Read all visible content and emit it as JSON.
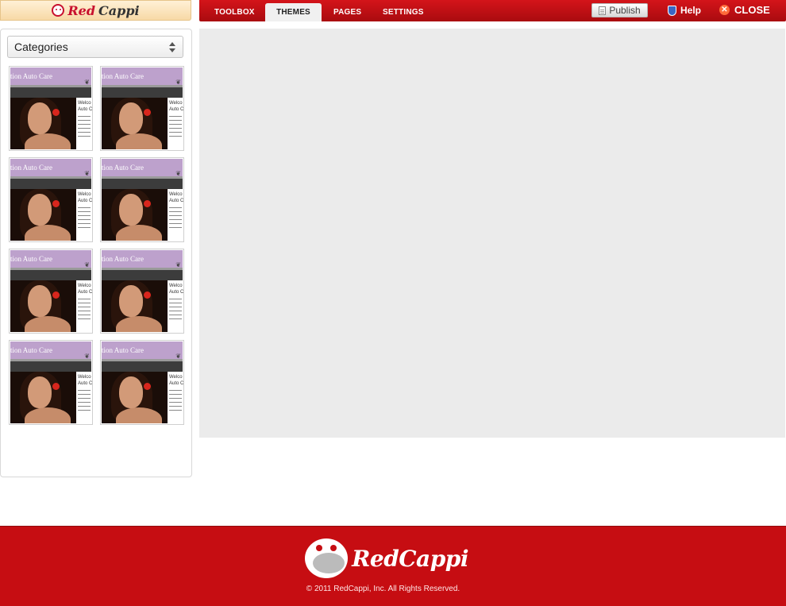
{
  "brand": {
    "name_part1": "Red",
    "name_part2": "Cappi",
    "footer_wordmark": "RedCappi"
  },
  "nav": {
    "tabs": [
      {
        "label": "TOOLBOX",
        "active": false
      },
      {
        "label": "THEMES",
        "active": true
      },
      {
        "label": "PAGES",
        "active": false
      },
      {
        "label": "SETTINGS",
        "active": false
      }
    ],
    "publish_label": "Publish",
    "help_label": "Help",
    "close_label": "CLOSE"
  },
  "sidebar": {
    "category_select": {
      "selected": "Categories"
    },
    "themes": [
      {
        "title": "tion Auto Care",
        "text_head": "Welco",
        "text_sub": "Auto C"
      },
      {
        "title": "tion Auto Care",
        "text_head": "Welco",
        "text_sub": "Auto C"
      },
      {
        "title": "tion Auto Care",
        "text_head": "Welco",
        "text_sub": "Auto C"
      },
      {
        "title": "tion Auto Care",
        "text_head": "Welco",
        "text_sub": "Auto C"
      },
      {
        "title": "tion Auto Care",
        "text_head": "Welco",
        "text_sub": "Auto C"
      },
      {
        "title": "tion Auto Care",
        "text_head": "Welco",
        "text_sub": "Auto C"
      },
      {
        "title": "tion Auto Care",
        "text_head": "Welco",
        "text_sub": "Auto C"
      },
      {
        "title": "tion Auto Care",
        "text_head": "Welco",
        "text_sub": "Auto C"
      }
    ]
  },
  "footer": {
    "copyright": "© 2011 RedCappi, Inc. All Rights Reserved."
  },
  "colors": {
    "brand_red": "#c60d12",
    "theme_purple": "#bda1cc",
    "canvas_gray": "#ebebeb"
  },
  "icons": [
    "smiley-logo-icon",
    "document-icon",
    "shield-icon",
    "close-icon",
    "select-arrows-icon",
    "monkey-logo-icon"
  ]
}
